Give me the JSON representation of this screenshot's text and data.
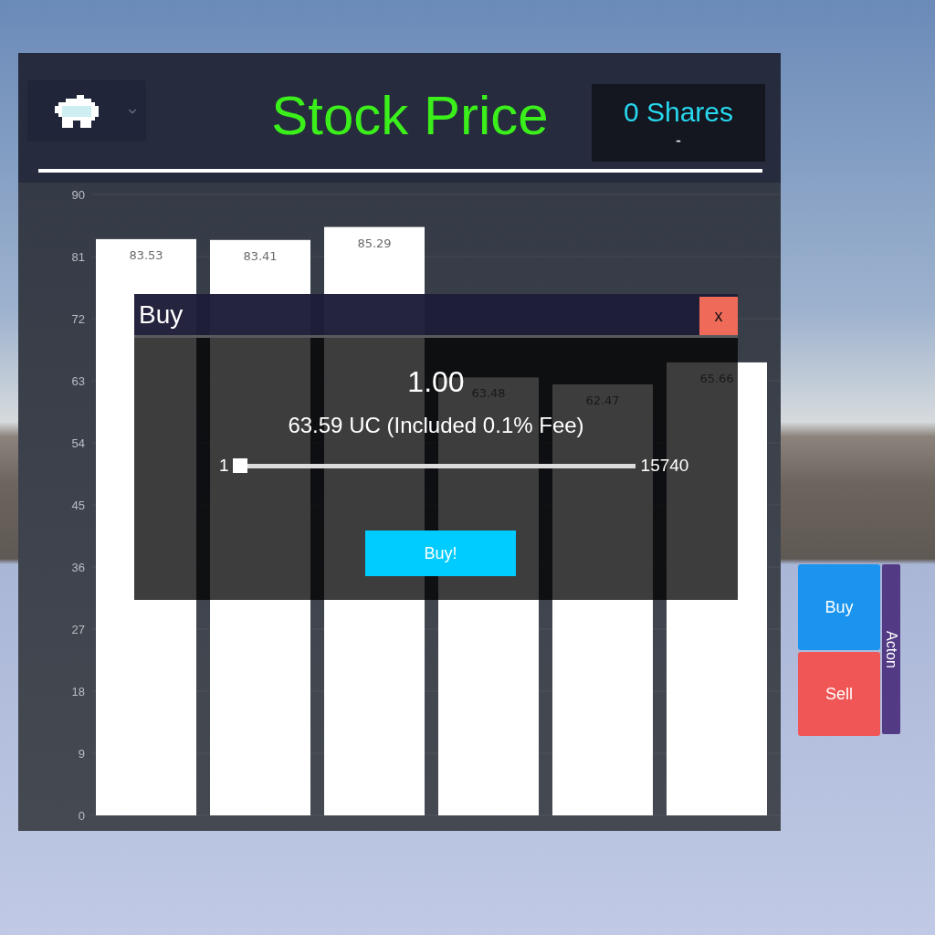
{
  "header": {
    "title": "Stock Price",
    "shares": "0 Shares",
    "shares_change": "-"
  },
  "chart": {
    "chart_data": {
      "type": "bar",
      "values": [
        83.53,
        83.41,
        85.29,
        63.48,
        62.47,
        65.66
      ],
      "ylim": [
        0,
        90
      ],
      "yticks": [
        0,
        9,
        18,
        27,
        36,
        45,
        54,
        63,
        72,
        81,
        90
      ],
      "grid": true,
      "data_labels": true
    }
  },
  "dialog": {
    "title": "Buy",
    "close": "x",
    "amount": "1.00",
    "cost": "63.59 UC (Included 0.1% Fee)",
    "slider": {
      "min": "1",
      "max": "15740",
      "level": 0
    },
    "confirm": "Buy!"
  },
  "actions": {
    "label": "Acton",
    "buttons": [
      {
        "kind": "buy",
        "label": "Buy"
      },
      {
        "kind": "sell",
        "label": "Sell"
      }
    ]
  }
}
